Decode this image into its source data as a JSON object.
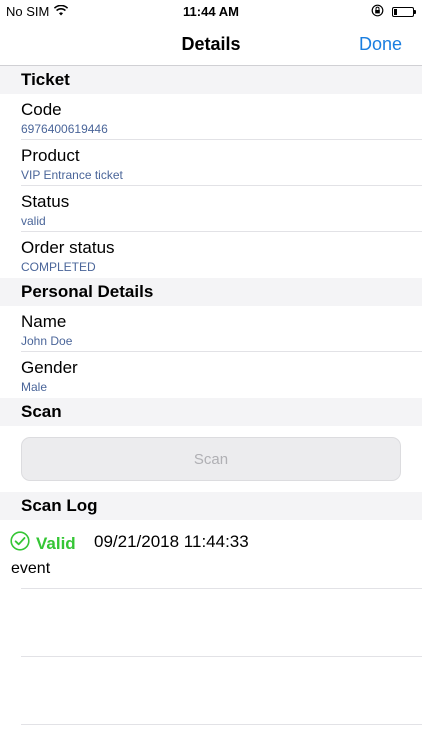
{
  "status_bar": {
    "carrier": "No SIM",
    "time": "11:44 AM",
    "battery_level": 0.15
  },
  "nav": {
    "title": "Details",
    "done_label": "Done"
  },
  "ticket": {
    "header": "Ticket",
    "code_label": "Code",
    "code_value": "6976400619446",
    "product_label": "Product",
    "product_value": "VIP Entrance ticket",
    "status_label": "Status",
    "status_value": "valid",
    "order_status_label": "Order status",
    "order_status_value": "COMPLETED"
  },
  "personal": {
    "header": "Personal Details",
    "name_label": "Name",
    "name_value": "John Doe",
    "gender_label": "Gender",
    "gender_value": "Male"
  },
  "scan": {
    "header": "Scan",
    "button_label": "Scan"
  },
  "scan_log": {
    "header": "Scan Log",
    "entries": [
      {
        "status": "Valid",
        "timestamp": "09/21/2018 11:44:33",
        "event": "event",
        "icon": "check-circle-icon",
        "status_color": "#35c635"
      }
    ]
  },
  "colors": {
    "accent": "#1a7ee0",
    "value_text": "#4a6599",
    "valid": "#35c635"
  }
}
